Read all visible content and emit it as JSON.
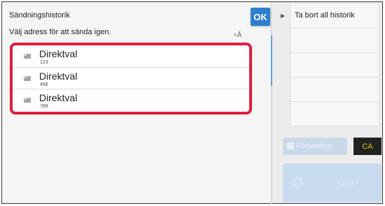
{
  "dialog": {
    "title": "Sändningshistorik",
    "subtitle": "Välj adress för att sända igen.",
    "ok_label": "OK",
    "font_size_icon": "⩡Ā"
  },
  "history": {
    "items": [
      {
        "name": "Direktval",
        "number": "123"
      },
      {
        "name": "Direktval",
        "number": "456"
      },
      {
        "name": "Direktval",
        "number": "789"
      }
    ]
  },
  "right_panel": {
    "arrow": "▶",
    "actions": [
      "Ta bort all historik",
      "",
      "",
      "",
      ""
    ],
    "secondary_label": "Förhandsgr.",
    "ca_label": "CA",
    "start_label": "Start"
  },
  "colors": {
    "accent": "#2f7fd0",
    "highlight_border": "#e01e3c",
    "ca_text": "#f3c300"
  }
}
